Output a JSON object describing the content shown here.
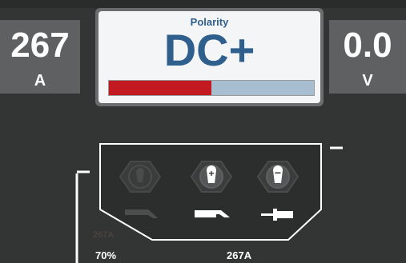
{
  "current": {
    "value": "267",
    "unit": "A"
  },
  "voltage": {
    "value": "0.0",
    "unit": "V"
  },
  "polarity": {
    "label": "Polarity",
    "value": "DC+",
    "bar_fraction": 0.5,
    "bar_fill_color": "#c31a22",
    "bar_track_color": "#a7bed0"
  },
  "connectors": [
    {
      "name": "gas-socket",
      "symbol": "",
      "icon": "torch-icon",
      "active": false
    },
    {
      "name": "positive-socket",
      "symbol": "+",
      "icon": "electrode-holder-icon",
      "active": true
    },
    {
      "name": "negative-socket",
      "symbol": "−",
      "icon": "ground-clamp-icon",
      "active": true
    }
  ],
  "footer": {
    "faded_value": "267A",
    "percent": "70%",
    "amps": "267A"
  }
}
